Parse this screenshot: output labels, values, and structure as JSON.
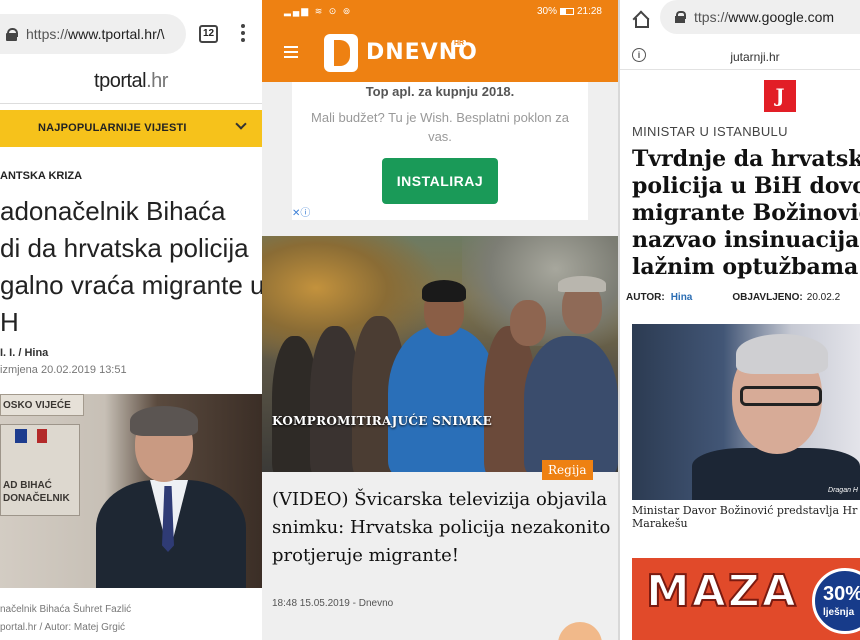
{
  "panel1": {
    "url_prefix": "https://",
    "url_host": "www.tportal.hr/\\",
    "tab_count": "12",
    "logo": "tportal",
    "logo_suffix": ".hr",
    "popular_label": "NAJPOPULARNIJE VIJESTI",
    "category": "ANTSKA KRIZA",
    "title_lines": [
      "adonačelnik Bihaća",
      "di da hrvatska policija",
      "galno vraća migrante u",
      "H"
    ],
    "author": "I. I. / Hina",
    "date": "izmjena 20.02.2019 13:51",
    "photo_sign_top": "OSKO VIJEĆE",
    "photo_sign_line1": "AD BIHAĆ",
    "photo_sign_line2": "DONAČELNIK",
    "caption_line1": "načelnik Bihaća Šuhret Fazlić",
    "caption_line2": "portal.hr / Autor: Matej Grgić"
  },
  "panel2": {
    "status_battery": "30%",
    "status_time": "21:28",
    "logo_text": "DNEVNO",
    "logo_hr": "HR",
    "ad_title": "Top apl. za kupnju 2018.",
    "ad_subtitle": "Mali budžet? Tu je Wish. Besplatni poklon za vas.",
    "ad_button": "INSTALIRAJ",
    "photo_caption": "KOMPROMITIRAJUĆE SNIMKE",
    "badge": "Regija",
    "title_lines": [
      "(VIDEO) Švicarska televizija objavila",
      "snimku: Hrvatska policija nezakonito",
      "protjeruje migrante!"
    ],
    "meta": "18:48 15.05.2019 - Dnevno"
  },
  "panel3": {
    "url_prefix": "ttps://",
    "url_host": "www.google.com",
    "domain": "jutarnji.hr",
    "logo_letter": "J",
    "category": "MINISTAR U ISTANBULU",
    "title_lines": [
      "Tvrdnje da hrvatska",
      "policija u BiH dovozi",
      "migrante Božinović",
      "nazvao insinuacijama",
      "lažnim optužbama"
    ],
    "author_label": "AUTOR:",
    "author_name": "Hina",
    "published_label": "OBJAVLJENO:",
    "published_date": "20.02.2",
    "photo_credit": "Dragan H",
    "caption_lines": [
      "Ministar Davor Božinović predstavlja Hr",
      "Marakešu"
    ],
    "banner_text": "MAZA",
    "banner_circle_top": "30%",
    "banner_circle_bottom": "lješnja"
  }
}
